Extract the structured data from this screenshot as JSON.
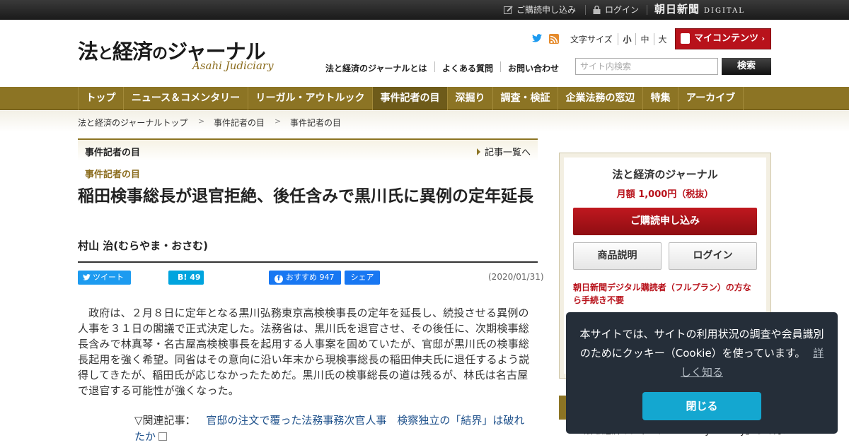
{
  "topbar": {
    "subscribe": "ご購読申し込み",
    "login": "ログイン",
    "brand_asahi": "朝日新聞",
    "brand_digital": "DIGITAL"
  },
  "header": {
    "logo_part1": "法",
    "logo_part2": "と",
    "logo_part3": "経済",
    "logo_part4": "の",
    "logo_part5": "ジャーナル",
    "logo_sub": "Asahi Judiciary",
    "font_size_label": "文字サイズ",
    "font_sizes": [
      "小",
      "中",
      "大"
    ],
    "font_size_selected": "小",
    "my_contents": "マイコンテンツ",
    "links": [
      "法と経済のジャーナルとは",
      "よくある質問",
      "お問い合わせ"
    ],
    "search_placeholder": "サイト内検索",
    "search_button": "検索"
  },
  "nav": {
    "items": [
      "トップ",
      "ニュース＆コメンタリー",
      "リーガル・アウトルック",
      "事件記者の目",
      "深掘り",
      "調査・検証",
      "企業法務の窓辺",
      "特集",
      "アーカイブ"
    ],
    "active": "事件記者の目"
  },
  "breadcrumb": [
    "法と経済のジャーナルトップ",
    "事件記者の目",
    "事件記者の目"
  ],
  "article": {
    "section_title": "事件記者の目",
    "section_list_link": "記事一覧へ",
    "category": "事件記者の目",
    "headline": "稲田検事総長が退官拒絶、後任含みで黒川氏に異例の定年延長",
    "author": "村山 治(むらやま・おさむ)",
    "share": {
      "tweet": "ツイート",
      "hatena_count": "49",
      "fb_like": "おすすめ 947",
      "fb_share": "シェア"
    },
    "date": "(2020/01/31)",
    "body": "政府は、２月８日に定年となる黒川弘務東京高検検事長の定年を延長し、続投させる異例の人事を３１日の閣議で正式決定した。法務省は、黒川氏を退官させ、その後任に、次期検事総長含みで林真琴・名古屋高検検事長を起用する人事案を固めていたが、官邸が黒川氏の検事総長起用を強く希望。同省はその意向に沿い年末から現検事総長の稲田伸夫氏に退任するよう説得してきたが、稲田氏が応じなかったためだ。黒川氏の検事総長の道は残るが、林氏は名古屋で退官する可能性が強くなった。",
    "related_label": "▽関連記事：",
    "related_link": "官邸の注文で覆った法務事務次官人事　検察独立の「結界」は破れたか"
  },
  "sidebar": {
    "title": "法と経済のジャーナル",
    "price": "月額 1,000円（税抜）",
    "subscribe": "ご購読申し込み",
    "product": "商品説明",
    "login": "ログイン",
    "note": "朝日新聞デジタル購読者（フルプラン）の方なら手続き不要",
    "lower_text": "法と経済のジャーナル Asahi Judiciary」って何？"
  },
  "cookie": {
    "text": "本サイトでは、サイトの利用状況の調査や会員識別のためにクッキー（Cookie）を使っています。",
    "link": "詳しく知る",
    "close": "閉じる"
  },
  "colors": {
    "nav_gold": "#8c7424",
    "brand_red": "#b8121b",
    "cookie_bg": "#252e39",
    "cookie_button": "#14a7d0"
  }
}
